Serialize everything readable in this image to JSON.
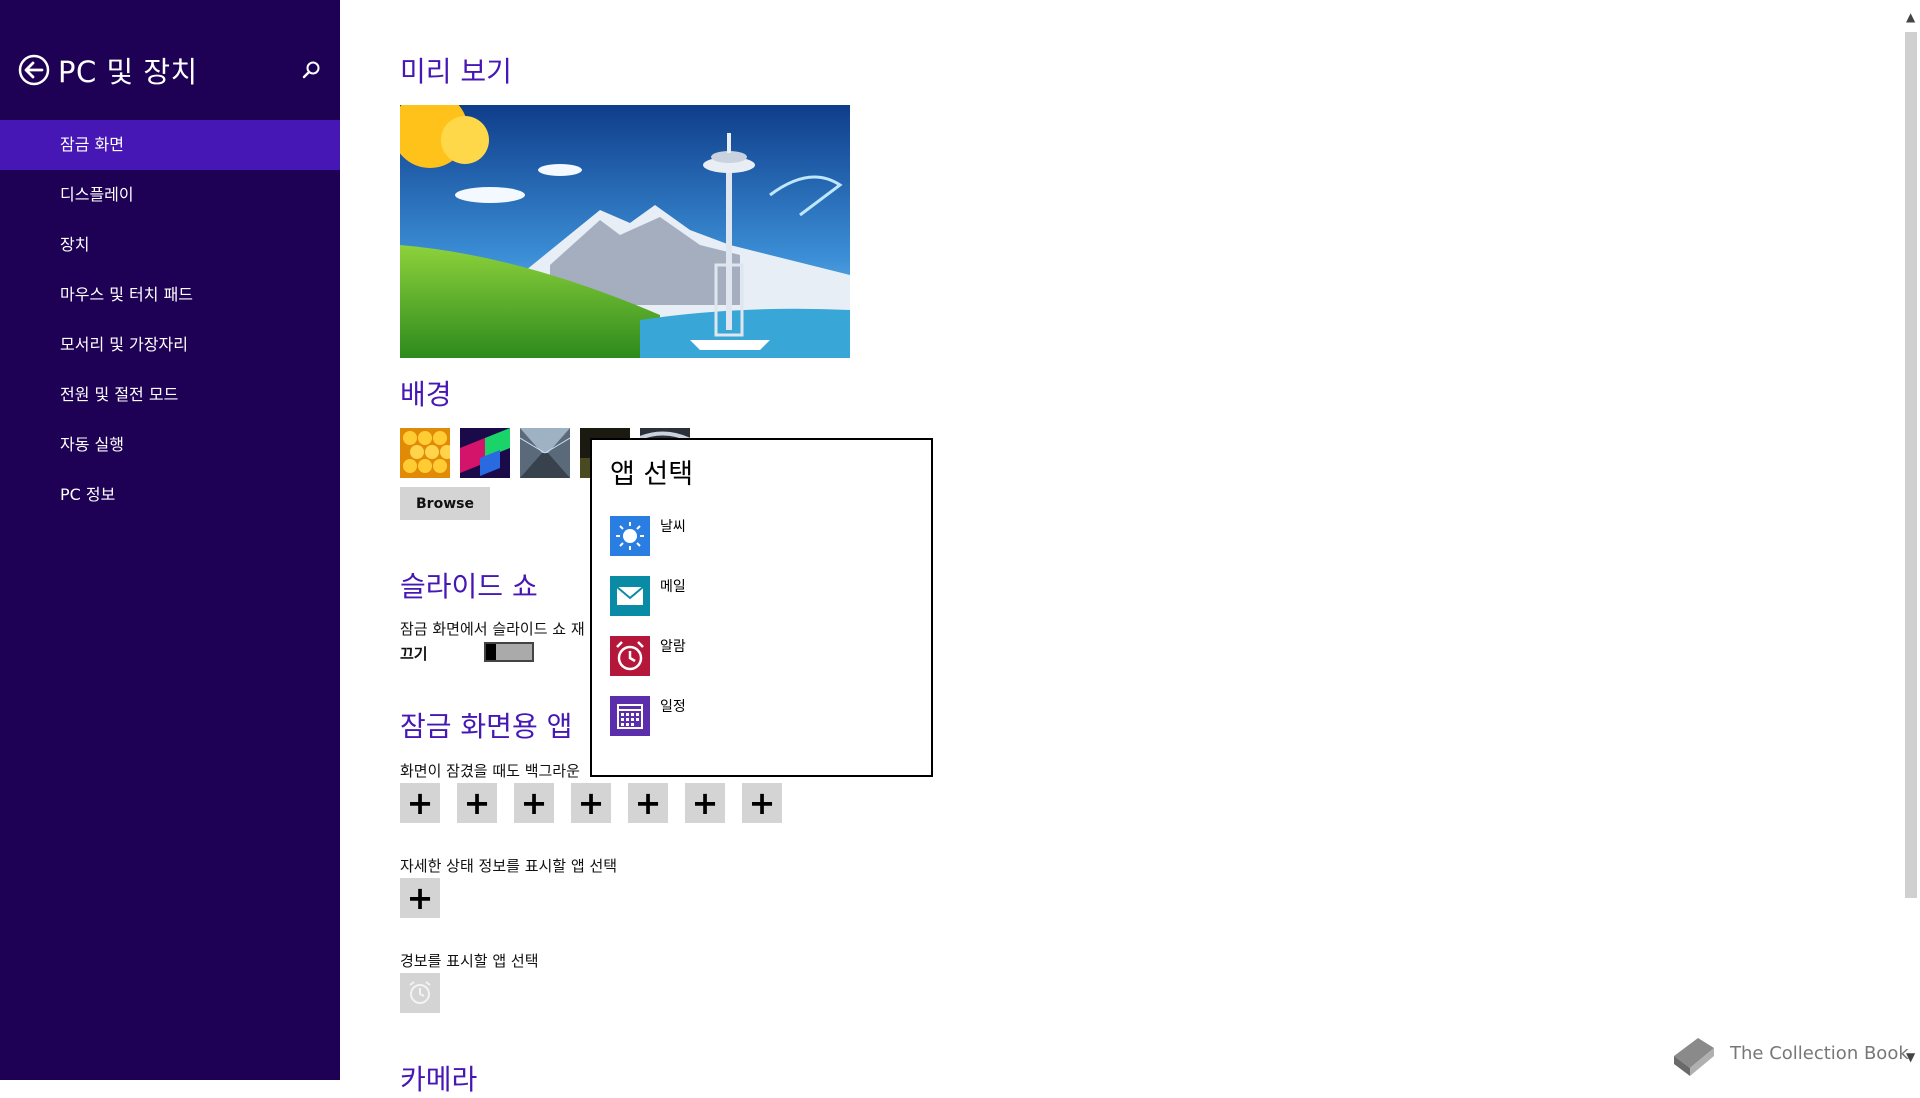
{
  "sidebar": {
    "title": "PC 및 장치",
    "items": [
      {
        "label": "잠금 화면",
        "active": true
      },
      {
        "label": "디스플레이"
      },
      {
        "label": "장치"
      },
      {
        "label": "마우스 및 터치 패드"
      },
      {
        "label": "모서리 및 가장자리"
      },
      {
        "label": "전원 및 절전 모드"
      },
      {
        "label": "자동 실행"
      },
      {
        "label": "PC 정보"
      }
    ]
  },
  "main": {
    "preview_heading": "미리 보기",
    "background_heading": "배경",
    "browse_label": "Browse",
    "slideshow_heading": "슬라이드 쇼",
    "slideshow_desc": "잠금 화면에서 슬라이드 쇼 재",
    "slideshow_state": "끄기",
    "lockapps_heading": "잠금 화면용 앱",
    "lockapps_desc": "화면이 잠겼을 때도 백그라운",
    "detailed_desc": "자세한 상태 정보를 표시할 앱 선택",
    "alarm_desc": "경보를 표시할 앱 선택",
    "camera_heading": "카메라",
    "plus_symbol": "+"
  },
  "popup": {
    "title": "앱 선택",
    "apps": [
      {
        "label": "날씨",
        "color": "#2a7de1",
        "icon": "sun-icon"
      },
      {
        "label": "메일",
        "color": "#0a8ba5",
        "icon": "mail-icon"
      },
      {
        "label": "알람",
        "color": "#b5173b",
        "icon": "alarm-icon"
      },
      {
        "label": "일정",
        "color": "#5b2eab",
        "icon": "calendar-icon"
      }
    ]
  },
  "watermark": "The Collection Book",
  "colors": {
    "sidebar_bg": "#1e0055",
    "accent": "#4617b4"
  }
}
